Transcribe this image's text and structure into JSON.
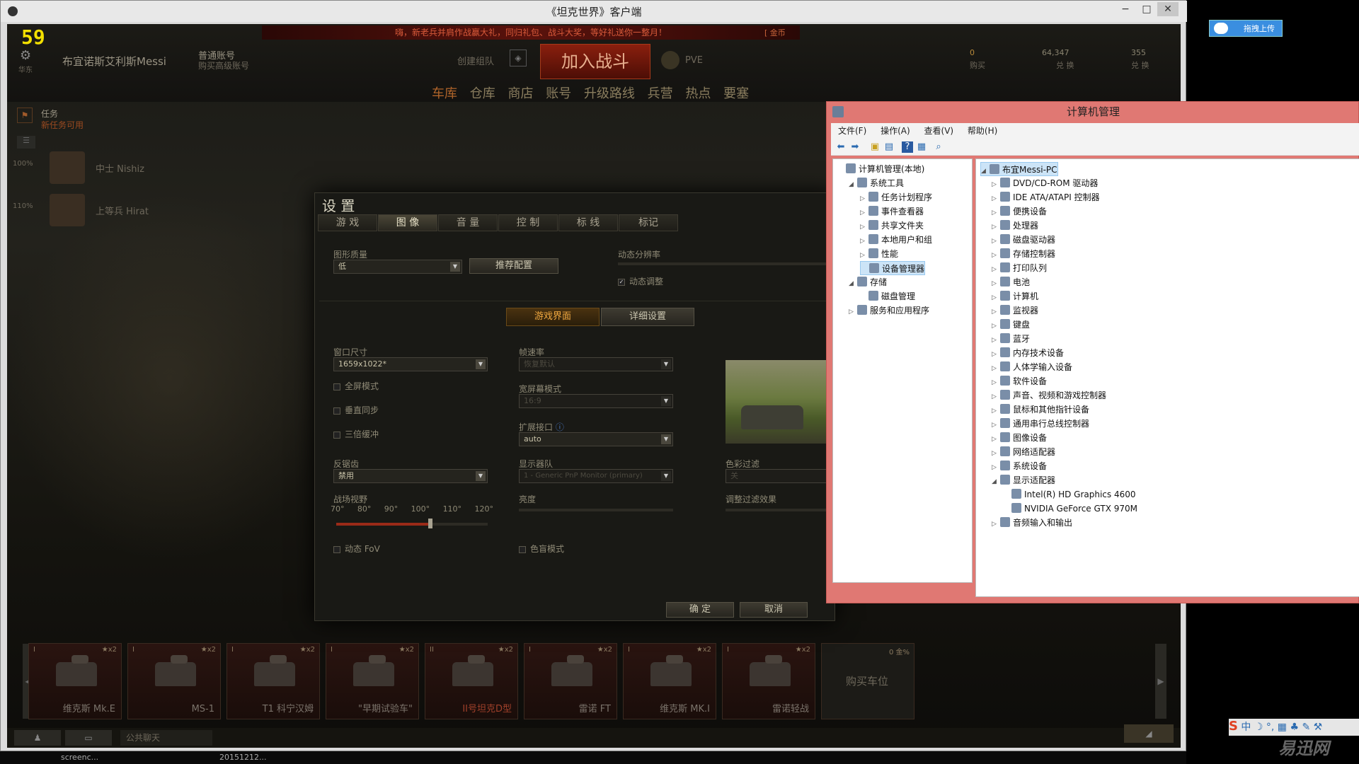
{
  "game_window": {
    "title": "《坦克世界》客户端",
    "min": "−",
    "max": "□",
    "close": "✕"
  },
  "hud": {
    "fps": "59",
    "settings_caption": "华东",
    "player_name": "布宜诺斯艾利斯Messi",
    "account_type": "普通账号",
    "account_upgrade": "购买高级账号",
    "notice": "嗨，新老兵并肩作战赢大礼，同归礼包、战斗大奖，等好礼送你一整月！",
    "notice_right": "[ 金币",
    "create_platoon": "创建组队",
    "battle_button": "加入战斗",
    "mode": "PVE",
    "gold": "0",
    "gold_label": "购买",
    "credits": "64,347",
    "credits_label": "兑 换",
    "free_xp": "355",
    "free_xp_label": "兑 换",
    "nav": [
      "车库",
      "仓库",
      "商店",
      "账号",
      "升级路线",
      "兵营",
      "热点",
      "要塞"
    ],
    "missions_title": "任务",
    "missions_sub": "新任务可用",
    "crew": [
      {
        "pct": "100%",
        "name": "中士 Nishiz"
      },
      {
        "pct": "110%",
        "name": "上等兵 Hirat"
      }
    ]
  },
  "settings": {
    "title": "设 置",
    "tabs": [
      "游 戏",
      "图 像",
      "音 量",
      "控 制",
      "标 线",
      "标记"
    ],
    "graphics_quality_label": "图形质量",
    "graphics_quality_value": "低",
    "recommend_button": "推荐配置",
    "dynamic_res_label": "动态分辨率",
    "dynamic_adjust_label": "动态调整",
    "subtab_game": "游戏界面",
    "subtab_detail": "详细设置",
    "window_size_label": "窗口尺寸",
    "window_size_value": "1659x1022*",
    "fullscreen": "全屏模式",
    "vsync": "垂直同步",
    "triple_buffer": "三倍缓冲",
    "aa_label": "反锯齿",
    "aa_value": "禁用",
    "fov_label": "战场视野",
    "fov_ticks": [
      "70°",
      "80°",
      "90°",
      "100°",
      "110°",
      "120°"
    ],
    "fov_value": 0.62,
    "dynamic_fov": "动态 FoV",
    "fps_label": "帧速率",
    "fps_value": "恢复默认",
    "widescreen_label": "宽屏幕模式",
    "widescreen_value": "16:9",
    "ext_label": "扩展接口",
    "ext_value": "auto",
    "monitor_label": "显示器队",
    "monitor_value": "1 - Generic PnP Monitor (primary)",
    "brightness_label": "亮度",
    "colorblind": "色盲模式",
    "color_filter_label": "色彩过滤",
    "color_filter_value": "关",
    "filter_effect_label": "调整过滤效果",
    "ok": "确 定",
    "cancel": "取消"
  },
  "carousel": [
    {
      "tier": "I",
      "stars": "★x2",
      "name": "维克斯 Mk.E"
    },
    {
      "tier": "I",
      "stars": "★x2",
      "name": "MS-1"
    },
    {
      "tier": "I",
      "stars": "★x2",
      "name": "T1 科宁汉姆"
    },
    {
      "tier": "I",
      "stars": "★x2",
      "name": "\"早期试验车\""
    },
    {
      "tier": "II",
      "stars": "★x2",
      "name": "II号坦克D型"
    },
    {
      "tier": "I",
      "stars": "★x2",
      "name": "雷诺 FT"
    },
    {
      "tier": "I",
      "stars": "★x2",
      "name": "维克斯 MK.I"
    },
    {
      "tier": "I",
      "stars": "★x2",
      "name": "雷诺轻战"
    }
  ],
  "buy_slot": {
    "label": "购买车位",
    "price": "0 金%"
  },
  "chat": {
    "label": "公共聊天"
  },
  "computer_mgmt": {
    "title": "计算机管理",
    "menus": [
      "文件(F)",
      "操作(A)",
      "查看(V)",
      "帮助(H)"
    ],
    "left_tree": [
      {
        "label": "计算机管理(本地)",
        "level": 0,
        "ex": ""
      },
      {
        "label": "系统工具",
        "level": 1,
        "ex": "◢"
      },
      {
        "label": "任务计划程序",
        "level": 2,
        "ex": "▷"
      },
      {
        "label": "事件查看器",
        "level": 2,
        "ex": "▷"
      },
      {
        "label": "共享文件夹",
        "level": 2,
        "ex": "▷"
      },
      {
        "label": "本地用户和组",
        "level": 2,
        "ex": "▷"
      },
      {
        "label": "性能",
        "level": 2,
        "ex": "▷"
      },
      {
        "label": "设备管理器",
        "level": 2,
        "ex": ""
      },
      {
        "label": "存储",
        "level": 1,
        "ex": "◢"
      },
      {
        "label": "磁盘管理",
        "level": 2,
        "ex": ""
      },
      {
        "label": "服务和应用程序",
        "level": 1,
        "ex": "▷"
      }
    ],
    "right_tree": [
      {
        "label": "布宜Messi-PC",
        "level": 0,
        "ex": "◢"
      },
      {
        "label": "DVD/CD-ROM 驱动器",
        "level": 1,
        "ex": "▷"
      },
      {
        "label": "IDE ATA/ATAPI 控制器",
        "level": 1,
        "ex": "▷"
      },
      {
        "label": "便携设备",
        "level": 1,
        "ex": "▷"
      },
      {
        "label": "处理器",
        "level": 1,
        "ex": "▷"
      },
      {
        "label": "磁盘驱动器",
        "level": 1,
        "ex": "▷"
      },
      {
        "label": "存储控制器",
        "level": 1,
        "ex": "▷"
      },
      {
        "label": "打印队列",
        "level": 1,
        "ex": "▷"
      },
      {
        "label": "电池",
        "level": 1,
        "ex": "▷"
      },
      {
        "label": "计算机",
        "level": 1,
        "ex": "▷"
      },
      {
        "label": "监视器",
        "level": 1,
        "ex": "▷"
      },
      {
        "label": "键盘",
        "level": 1,
        "ex": "▷"
      },
      {
        "label": "蓝牙",
        "level": 1,
        "ex": "▷"
      },
      {
        "label": "内存技术设备",
        "level": 1,
        "ex": "▷"
      },
      {
        "label": "人体学输入设备",
        "level": 1,
        "ex": "▷"
      },
      {
        "label": "软件设备",
        "level": 1,
        "ex": "▷"
      },
      {
        "label": "声音、视频和游戏控制器",
        "level": 1,
        "ex": "▷"
      },
      {
        "label": "鼠标和其他指针设备",
        "level": 1,
        "ex": "▷"
      },
      {
        "label": "通用串行总线控制器",
        "level": 1,
        "ex": "▷"
      },
      {
        "label": "图像设备",
        "level": 1,
        "ex": "▷"
      },
      {
        "label": "网络适配器",
        "level": 1,
        "ex": "▷"
      },
      {
        "label": "系统设备",
        "level": 1,
        "ex": "▷"
      },
      {
        "label": "显示适配器",
        "level": 1,
        "ex": "◢"
      },
      {
        "label": "Intel(R) HD Graphics 4600",
        "level": 2,
        "ex": ""
      },
      {
        "label": "NVIDIA GeForce GTX 970M",
        "level": 2,
        "ex": ""
      },
      {
        "label": "音频输入和输出",
        "level": 1,
        "ex": "▷"
      }
    ]
  },
  "taskbar": {
    "item1": "screenc...",
    "item2": "20151212..."
  },
  "upload_label": "拖拽上传",
  "ime": "中 ☽ °, ▦ ♣ ✎ ⚒",
  "watermark": "易迅网"
}
